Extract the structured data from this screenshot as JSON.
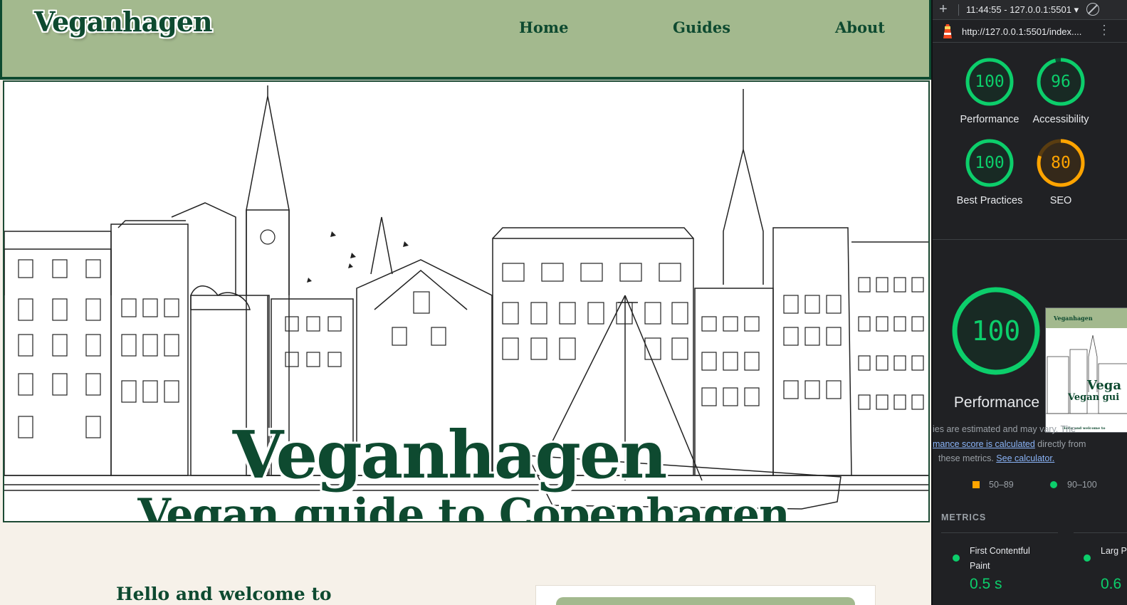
{
  "site": {
    "logo": "Veganhagen",
    "nav": {
      "home": "Home",
      "guides": "Guides",
      "about": "About"
    },
    "hero": {
      "title": "Veganhagen",
      "subtitle": "Vegan guide to Copenhagen"
    },
    "welcome_heading": "Hello and welcome to",
    "colors": {
      "header_bg": "#a3b98e",
      "brand_green": "#0e4a30",
      "page_bg": "#f6f1e9"
    }
  },
  "devtools": {
    "report_selector": "11:44:55 - 127.0.0.1:5501",
    "url": "http://127.0.0.1:5501/index....",
    "scores": [
      {
        "label": "Performance",
        "value": 100,
        "rating": "good"
      },
      {
        "label": "Accessibility",
        "value": 96,
        "rating": "good"
      },
      {
        "label": "Best Practices",
        "value": 100,
        "rating": "good"
      },
      {
        "label": "SEO",
        "value": 80,
        "rating": "average"
      }
    ],
    "featured": {
      "label": "Performance",
      "value": 100
    },
    "thumbnail": {
      "logo": "Veganhagen",
      "title": "Vega",
      "subtitle": "Vegan gui",
      "welcome": "Hello and welcome to"
    },
    "notes": {
      "line1": "ies are estimated and may vary. The",
      "line2_link": "mance score is calculated",
      "line2_rest": " directly from",
      "line3": "these metrics. ",
      "line3_link": "See calculator."
    },
    "legend": {
      "average": "50–89",
      "good": "90–100"
    },
    "metrics_title": "METRICS",
    "metrics": [
      {
        "name": "First Contentful Paint",
        "value": "0.5 s"
      },
      {
        "name": "Larg Pain",
        "value": "0.6"
      }
    ],
    "colors": {
      "good": "#0cce6b",
      "average": "#ffa400",
      "panel_bg": "#202124",
      "link": "#8ab4f8"
    }
  }
}
